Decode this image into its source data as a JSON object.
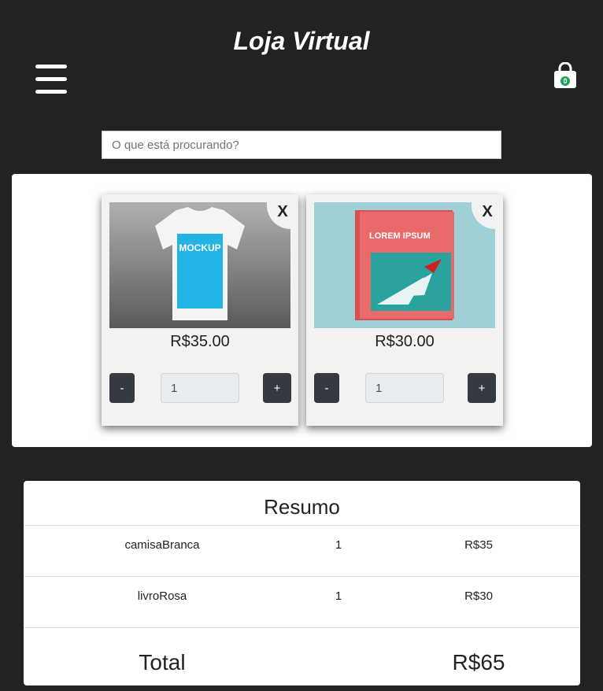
{
  "header": {
    "title": "Loja Virtual",
    "cart_count": "0"
  },
  "search": {
    "placeholder": "O que está procurando?"
  },
  "products": [
    {
      "name": "camisaBranca",
      "price": "R$35.00",
      "quantity": "1",
      "close_label": "X",
      "minus_label": "-",
      "plus_label": "+",
      "image_text": "MOCKUP"
    },
    {
      "name": "livroRosa",
      "price": "R$30.00",
      "quantity": "1",
      "close_label": "X",
      "minus_label": "-",
      "plus_label": "+",
      "image_text": "LOREM IPSUM"
    }
  ],
  "summary": {
    "title": "Resumo",
    "rows": [
      {
        "item": "camisaBranca",
        "qty": "1",
        "price": "R$35"
      },
      {
        "item": "livroRosa",
        "qty": "1",
        "price": "R$30"
      }
    ],
    "total_label": "Total",
    "total_value": "R$65"
  },
  "colors": {
    "background": "#222222",
    "button": "#343a40",
    "badge": "#20a05a"
  }
}
